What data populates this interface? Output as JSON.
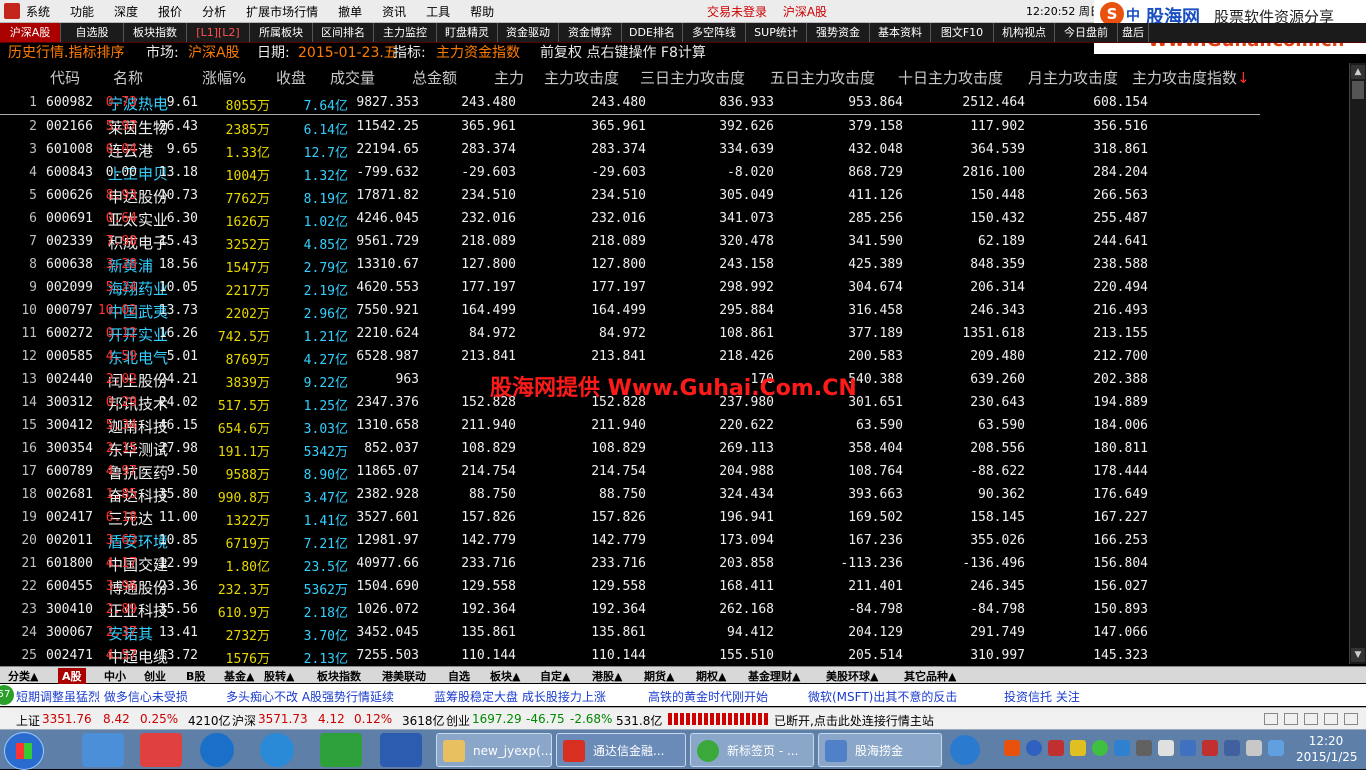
{
  "menubar": {
    "items": [
      "系统",
      "功能",
      "深度",
      "报价",
      "分析",
      "扩展市场行情",
      "撤单",
      "资讯",
      "工具",
      "帮助"
    ],
    "center": [
      "交易未登录",
      "沪深A股"
    ],
    "clock": "12:20:52 周日"
  },
  "logo": {
    "mark": "S",
    "zh": "中",
    "name": "股海网",
    "slogan": "股票软件资源分享",
    "url": "Www.Guhai.com.cn"
  },
  "tabs": [
    "沪深A股",
    "自选股",
    "板块指数",
    "[L1][L2]",
    "所属板块",
    "区间排名",
    "主力监控",
    "盯盘精灵",
    "资金驱动",
    "资金博弈",
    "DDE排名",
    "多空阵线",
    "SUP统计",
    "强势资金",
    "基本资料",
    "图文F10",
    "机构视点",
    "今日盘前",
    "盘后"
  ],
  "title": {
    "label": "历史行情.指标排序",
    "market_label": "市场:",
    "market": "沪深A股",
    "date_label": "日期:",
    "date": "2015-01-23.五",
    "indicator_label": "指标:",
    "indicator": "主力资金指数",
    "extra": "前复权 点右键操作 F8计算"
  },
  "columns": [
    "代码",
    "名称",
    "涨幅%",
    "收盘",
    "成交量",
    "总金额",
    "主力",
    "主力攻击度",
    "三日主力攻击度",
    "五日主力攻击度",
    "十日主力攻击度",
    "月主力攻击度",
    "主力攻击度指数"
  ],
  "sort_arrow": "↓",
  "rows": [
    {
      "idx": "1",
      "code": "600982",
      "name": "宁波热电",
      "chg": "0.73",
      "price": "9.61",
      "vol": "8055",
      "vol_unit": "万",
      "amt": "7.64",
      "amt_unit": "亿",
      "main": "9827.353",
      "a": "243.480",
      "b": "243.480",
      "c": "836.933",
      "d": "953.864",
      "e": "2512.464",
      "f": "608.154"
    },
    {
      "idx": "2",
      "code": "002166",
      "name": "莱茵生物",
      "chg": "5.97",
      "price": "26.43",
      "vol": "2385",
      "vol_unit": "万",
      "amt": "6.14",
      "amt_unit": "亿",
      "main": "11542.25",
      "a": "365.961",
      "b": "365.961",
      "c": "392.626",
      "d": "379.158",
      "e": "117.902",
      "f": "356.516"
    },
    {
      "idx": "3",
      "code": "601008",
      "name": "连云港",
      "chg": "6.04",
      "price": "9.65",
      "vol": "1.33",
      "vol_unit": "亿",
      "amt": "12.7",
      "amt_unit": "亿",
      "main": "22194.65",
      "a": "283.374",
      "b": "283.374",
      "c": "334.639",
      "d": "432.048",
      "e": "364.539",
      "f": "318.861"
    },
    {
      "idx": "4",
      "code": "600843",
      "name": "上工申贝",
      "chg": "0.00",
      "price": "13.18",
      "vol": "1004",
      "vol_unit": "万",
      "amt": "1.32",
      "amt_unit": "亿",
      "main": "-799.632",
      "a": "-29.603",
      "b": "-29.603",
      "c": "-8.020",
      "d": "868.729",
      "e": "2816.100",
      "f": "284.204"
    },
    {
      "idx": "5",
      "code": "600626",
      "name": "申达股份",
      "chg": "8.93",
      "price": "10.73",
      "vol": "7762",
      "vol_unit": "万",
      "amt": "8.19",
      "amt_unit": "亿",
      "main": "17871.82",
      "a": "234.510",
      "b": "234.510",
      "c": "305.049",
      "d": "411.126",
      "e": "150.448",
      "f": "266.563"
    },
    {
      "idx": "6",
      "code": "000691",
      "name": "亚太实业",
      "chg": "0.64",
      "price": "6.30",
      "vol": "1626",
      "vol_unit": "万",
      "amt": "1.02",
      "amt_unit": "亿",
      "main": "4246.045",
      "a": "232.016",
      "b": "232.016",
      "c": "341.073",
      "d": "285.256",
      "e": "150.432",
      "f": "255.487"
    },
    {
      "idx": "7",
      "code": "002339",
      "name": "积成电子",
      "chg": "7.98",
      "price": "15.43",
      "vol": "3252",
      "vol_unit": "万",
      "amt": "4.85",
      "amt_unit": "亿",
      "main": "9561.729",
      "a": "218.089",
      "b": "218.089",
      "c": "320.478",
      "d": "341.590",
      "e": "62.189",
      "f": "244.641"
    },
    {
      "idx": "8",
      "code": "600638",
      "name": "新黄浦",
      "chg": "3.28",
      "price": "18.56",
      "vol": "1547",
      "vol_unit": "万",
      "amt": "2.79",
      "amt_unit": "亿",
      "main": "13310.67",
      "a": "127.800",
      "b": "127.800",
      "c": "243.158",
      "d": "425.389",
      "e": "848.359",
      "f": "238.588"
    },
    {
      "idx": "9",
      "code": "002099",
      "name": "海翔药业",
      "chg": "5.24",
      "price": "10.05",
      "vol": "2217",
      "vol_unit": "万",
      "amt": "2.19",
      "amt_unit": "亿",
      "main": "4620.553",
      "a": "177.197",
      "b": "177.197",
      "c": "298.992",
      "d": "304.674",
      "e": "206.314",
      "f": "220.494"
    },
    {
      "idx": "10",
      "code": "000797",
      "name": "中国武夷",
      "chg": "10.02",
      "price": "13.73",
      "vol": "2202",
      "vol_unit": "万",
      "amt": "2.96",
      "amt_unit": "亿",
      "main": "7550.921",
      "a": "164.499",
      "b": "164.499",
      "c": "295.884",
      "d": "316.458",
      "e": "246.343",
      "f": "216.493"
    },
    {
      "idx": "11",
      "code": "600272",
      "name": "开开实业",
      "chg": "0.12",
      "price": "16.26",
      "vol": "742.5",
      "vol_unit": "万",
      "amt": "1.21",
      "amt_unit": "亿",
      "main": "2210.624",
      "a": "84.972",
      "b": "84.972",
      "c": "108.861",
      "d": "377.189",
      "e": "1351.618",
      "f": "213.155"
    },
    {
      "idx": "12",
      "code": "000585",
      "name": "东北电气",
      "chg": "4.59",
      "price": "5.01",
      "vol": "8769",
      "vol_unit": "万",
      "amt": "4.27",
      "amt_unit": "亿",
      "main": "6528.987",
      "a": "213.841",
      "b": "213.841",
      "c": "218.426",
      "d": "200.583",
      "e": "209.480",
      "f": "212.700"
    },
    {
      "idx": "13",
      "code": "002440",
      "name": "闰土股份",
      "chg": "2.02",
      "price": "24.21",
      "vol": "3839",
      "vol_unit": "万",
      "amt": "9.22",
      "amt_unit": "亿",
      "main": "963",
      "a": "",
      "b": "",
      "c": "170",
      "d": "540.388",
      "e": "639.260",
      "f": "202.388"
    },
    {
      "idx": "14",
      "code": "300312",
      "name": "邦讯技术",
      "chg": "0.29",
      "price": "24.02",
      "vol": "517.5",
      "vol_unit": "万",
      "amt": "1.25",
      "amt_unit": "亿",
      "main": "2347.376",
      "a": "152.828",
      "b": "152.828",
      "c": "237.980",
      "d": "301.651",
      "e": "230.643",
      "f": "194.889"
    },
    {
      "idx": "15",
      "code": "300412",
      "name": "迦南科技",
      "chg": "5.34",
      "price": "46.15",
      "vol": "654.6",
      "vol_unit": "万",
      "amt": "3.03",
      "amt_unit": "亿",
      "main": "1310.658",
      "a": "211.940",
      "b": "211.940",
      "c": "220.622",
      "d": "63.590",
      "e": "63.590",
      "f": "184.006"
    },
    {
      "idx": "16",
      "code": "300354",
      "name": "东华测试",
      "chg": "2.15",
      "price": "27.98",
      "vol": "191.1",
      "vol_unit": "万",
      "amt": "5342",
      "amt_unit": "万",
      "main": "852.037",
      "a": "108.829",
      "b": "108.829",
      "c": "269.113",
      "d": "358.404",
      "e": "208.556",
      "f": "180.811"
    },
    {
      "idx": "17",
      "code": "600789",
      "name": "鲁抗医药",
      "chg": "4.97",
      "price": "9.50",
      "vol": "9588",
      "vol_unit": "万",
      "amt": "8.90",
      "amt_unit": "亿",
      "main": "11865.07",
      "a": "214.754",
      "b": "214.754",
      "c": "204.988",
      "d": "108.764",
      "e": "-88.622",
      "f": "178.444"
    },
    {
      "idx": "18",
      "code": "002681",
      "name": "奋达科技",
      "chg": "1.85",
      "price": "35.80",
      "vol": "990.8",
      "vol_unit": "万",
      "amt": "3.47",
      "amt_unit": "亿",
      "main": "2382.928",
      "a": "88.750",
      "b": "88.750",
      "c": "324.434",
      "d": "393.663",
      "e": "90.362",
      "f": "176.649"
    },
    {
      "idx": "19",
      "code": "002417",
      "name": "三元达",
      "chg": "6.18",
      "price": "11.00",
      "vol": "1322",
      "vol_unit": "万",
      "amt": "1.41",
      "amt_unit": "亿",
      "main": "3527.601",
      "a": "157.826",
      "b": "157.826",
      "c": "196.941",
      "d": "169.502",
      "e": "158.145",
      "f": "167.227"
    },
    {
      "idx": "20",
      "code": "002011",
      "name": "盾安环境",
      "chg": "3.63",
      "price": "10.85",
      "vol": "6719",
      "vol_unit": "万",
      "amt": "7.21",
      "amt_unit": "亿",
      "main": "12981.97",
      "a": "142.779",
      "b": "142.779",
      "c": "173.094",
      "d": "167.236",
      "e": "355.026",
      "f": "166.253"
    },
    {
      "idx": "21",
      "code": "601800",
      "name": "中国交建",
      "chg": "4.17",
      "price": "12.99",
      "vol": "1.80",
      "vol_unit": "亿",
      "amt": "23.5",
      "amt_unit": "亿",
      "main": "40977.66",
      "a": "233.716",
      "b": "233.716",
      "c": "203.858",
      "d": "-113.236",
      "e": "-136.496",
      "f": "156.804"
    },
    {
      "idx": "22",
      "code": "600455",
      "name": "博通股份",
      "chg": "3.96",
      "price": "23.36",
      "vol": "232.3",
      "vol_unit": "万",
      "amt": "5362",
      "amt_unit": "万",
      "main": "1504.690",
      "a": "129.558",
      "b": "129.558",
      "c": "168.411",
      "d": "211.401",
      "e": "246.345",
      "f": "156.027"
    },
    {
      "idx": "23",
      "code": "300410",
      "name": "正业科技",
      "chg": "2.89",
      "price": "35.56",
      "vol": "610.9",
      "vol_unit": "万",
      "amt": "2.18",
      "amt_unit": "亿",
      "main": "1026.072",
      "a": "192.364",
      "b": "192.364",
      "c": "262.168",
      "d": "-84.798",
      "e": "-84.798",
      "f": "150.893"
    },
    {
      "idx": "24",
      "code": "300067",
      "name": "安诺其",
      "chg": "2.37",
      "price": "13.41",
      "vol": "2732",
      "vol_unit": "万",
      "amt": "3.70",
      "amt_unit": "亿",
      "main": "3452.045",
      "a": "135.861",
      "b": "135.861",
      "c": "94.412",
      "d": "204.129",
      "e": "291.749",
      "f": "147.066"
    },
    {
      "idx": "25",
      "code": "002471",
      "name": "中超电缆",
      "chg": "4.57",
      "price": "13.72",
      "vol": "1576",
      "vol_unit": "万",
      "amt": "2.13",
      "amt_unit": "亿",
      "main": "7255.503",
      "a": "110.144",
      "b": "110.144",
      "c": "155.510",
      "d": "205.514",
      "e": "310.997",
      "f": "145.323"
    }
  ],
  "name_colors": [
    "cyan",
    "white",
    "white",
    "cyan",
    "white",
    "white",
    "white",
    "cyan",
    "cyan",
    "cyan",
    "cyan",
    "cyan",
    "white",
    "white",
    "white",
    "white",
    "white",
    "white",
    "white",
    "cyan",
    "white",
    "white",
    "white",
    "cyan",
    "white"
  ],
  "colors": {
    "up": "#ff3232",
    "flat": "#f0f0f0",
    "volume": "#e8d800",
    "amount": "#33d0ff",
    "title": "#ff7b00",
    "accent": "#aa0000"
  },
  "watermark": "股海网提供 Www.Guhai.Com.CN",
  "market_tabs": [
    "分类▲",
    "A股",
    "中小",
    "创业",
    "B股",
    "基金▲",
    "股转▲",
    "板块指数",
    "港美联动",
    "自选",
    "板块▲",
    "自定▲",
    "港股▲",
    "期货▲",
    "期权▲",
    "基金理财▲",
    "美股环球▲",
    "其它品种▲"
  ],
  "ticker": {
    "badge": "57",
    "items": [
      "短期调整虽猛烈 做多信心未受损",
      "多头痴心不改 A股强势行情延续",
      "蓝筹股稳定大盘 成长股接力上涨",
      "高铁的黄金时代刚开始",
      "微软(MSFT)出其不意的反击",
      "投资信托 关注"
    ]
  },
  "indices": {
    "sh_label": "上证",
    "sh_val": "3351.76",
    "sh_chg": "8.42",
    "sh_pct": "0.25%",
    "sh_amt": "4210亿",
    "hs_label": "沪深",
    "hs_val": "3571.73",
    "hs_chg": "4.12",
    "hs_pct": "0.12%",
    "hs_amt": "3618亿",
    "cy_label": "创业",
    "cy_val": "1697.29",
    "cy_chg": "-46.75",
    "cy_pct": "-2.68%",
    "cy_amt": "531.8亿",
    "status": "已断开,点击此处连接行情主站"
  },
  "taskbar": {
    "tasks": [
      "new_jyexp(...",
      "通达信金融...",
      "新标签页 - ...",
      "股海捞金"
    ],
    "time": "12:20",
    "date": "2015/1/25"
  },
  "scroll_icons": [
    "triangle-up-icon",
    "triangle-down-icon"
  ]
}
